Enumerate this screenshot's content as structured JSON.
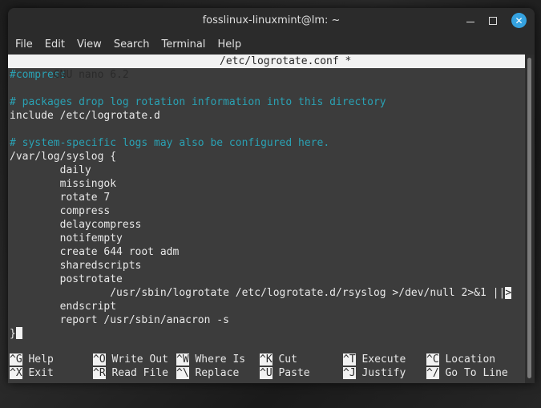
{
  "window": {
    "title": "fosslinux-linuxmint@lm: ~",
    "controls": [
      "minimize",
      "maximize",
      "close"
    ]
  },
  "menu": [
    "File",
    "Edit",
    "View",
    "Search",
    "Terminal",
    "Help"
  ],
  "nano": {
    "version": " GNU nano 6.2",
    "filename": "/etc/logrotate.conf *"
  },
  "lines": [
    {
      "text": "#compress",
      "type": "comment"
    },
    {
      "text": "",
      "type": "code"
    },
    {
      "text": "# packages drop log rotation information into this directory",
      "type": "comment"
    },
    {
      "text": "include /etc/logrotate.d",
      "type": "code"
    },
    {
      "text": "",
      "type": "code"
    },
    {
      "text": "# system-specific logs may also be configured here.",
      "type": "comment"
    },
    {
      "text": "/var/log/syslog {",
      "type": "code"
    },
    {
      "text": "        daily",
      "type": "code"
    },
    {
      "text": "        missingok",
      "type": "code"
    },
    {
      "text": "        rotate 7",
      "type": "code"
    },
    {
      "text": "        compress",
      "type": "code"
    },
    {
      "text": "        delaycompress",
      "type": "code"
    },
    {
      "text": "        notifempty",
      "type": "code"
    },
    {
      "text": "        create 644 root adm",
      "type": "code"
    },
    {
      "text": "        sharedscripts",
      "type": "code"
    },
    {
      "text": "        postrotate",
      "type": "code"
    },
    {
      "text": "                /usr/sbin/logrotate /etc/logrotate.d/rsyslog >/dev/null 2>&1 ||",
      "type": "code",
      "overflow": ">"
    },
    {
      "text": "        endscript",
      "type": "code"
    },
    {
      "text": "        report /usr/sbin/anacron -s",
      "type": "code"
    },
    {
      "text": "}",
      "type": "cursor-line"
    }
  ],
  "shortcuts": [
    {
      "key": "^G",
      "label": " Help"
    },
    {
      "key": "^O",
      "label": " Write Out"
    },
    {
      "key": "^W",
      "label": " Where Is"
    },
    {
      "key": "^K",
      "label": " Cut"
    },
    {
      "key": "^T",
      "label": " Execute"
    },
    {
      "key": "^C",
      "label": " Location"
    },
    {
      "key": "^X",
      "label": " Exit"
    },
    {
      "key": "^R",
      "label": " Read File"
    },
    {
      "key": "^\\",
      "label": " Replace"
    },
    {
      "key": "^U",
      "label": " Paste"
    },
    {
      "key": "^J",
      "label": " Justify"
    },
    {
      "key": "^/",
      "label": " Go To Line"
    }
  ],
  "colors": {
    "comment": "#2aa1b3",
    "close_button": "#35a2e0",
    "terminal_bg": "#3c3c3c"
  }
}
